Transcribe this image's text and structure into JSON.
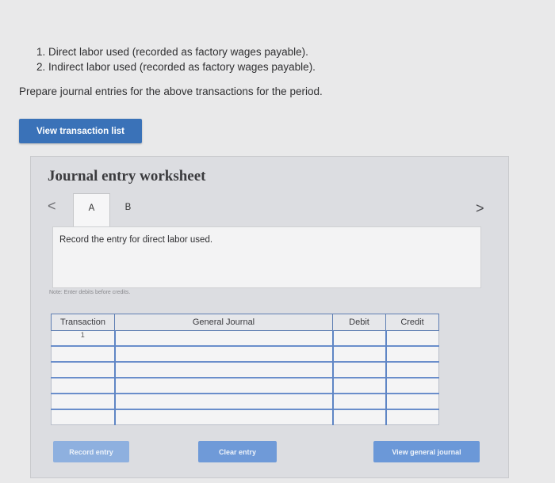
{
  "instructions": [
    "1. Direct labor used (recorded as factory wages payable).",
    "2. Indirect labor used (recorded as factory wages payable)."
  ],
  "prompt": "Prepare journal entries for the above transactions for the period.",
  "view_transaction_label": "View transaction list",
  "worksheet": {
    "title": "Journal entry worksheet",
    "prev_glyph": "<",
    "next_glyph": ">",
    "tabs": [
      {
        "label": "A",
        "active": true
      },
      {
        "label": "B",
        "active": false
      }
    ],
    "entry_instruction": "Record the entry for direct labor used.",
    "note": "Note: Enter debits before credits."
  },
  "table": {
    "headers": [
      "Transaction",
      "General Journal",
      "Debit",
      "Credit"
    ],
    "rows": [
      {
        "transaction": "1",
        "account": "",
        "debit": "",
        "credit": ""
      },
      {
        "transaction": "",
        "account": "",
        "debit": "",
        "credit": ""
      },
      {
        "transaction": "",
        "account": "",
        "debit": "",
        "credit": ""
      },
      {
        "transaction": "",
        "account": "",
        "debit": "",
        "credit": ""
      },
      {
        "transaction": "",
        "account": "",
        "debit": "",
        "credit": ""
      },
      {
        "transaction": "",
        "account": "",
        "debit": "",
        "credit": ""
      }
    ]
  },
  "buttons": {
    "record": "Record entry",
    "clear": "Clear entry",
    "view_journal": "View general journal"
  }
}
